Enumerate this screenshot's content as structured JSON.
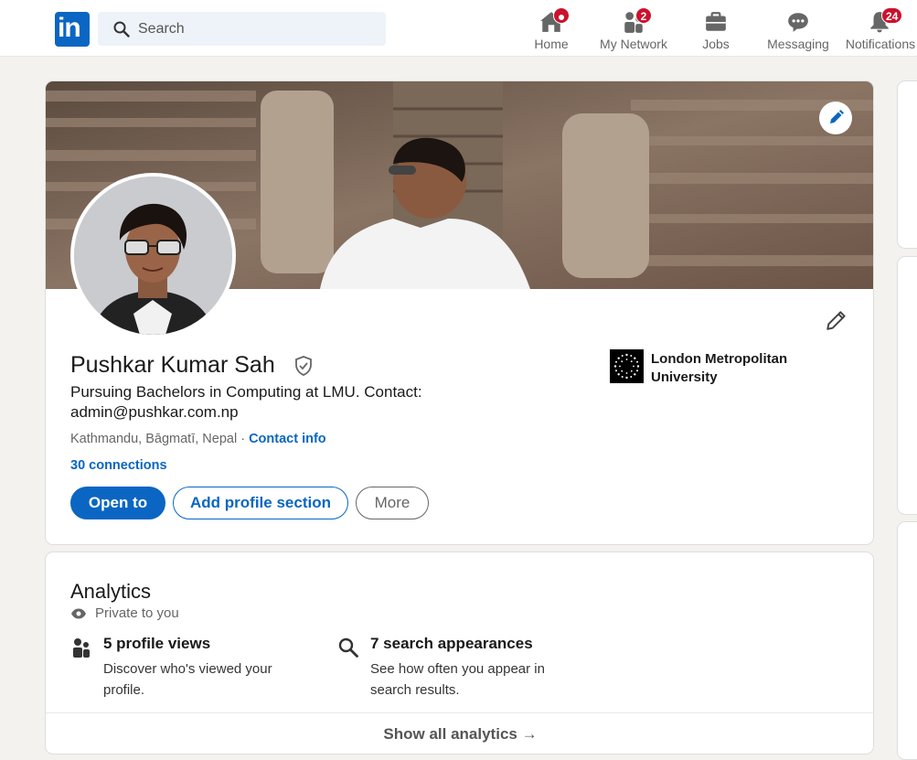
{
  "nav": {
    "logo_text": "in",
    "search_placeholder": "Search",
    "items": [
      {
        "label": "Home",
        "icon": "home-icon",
        "badge": ""
      },
      {
        "label": "My Network",
        "icon": "network-icon",
        "badge": "2"
      },
      {
        "label": "Jobs",
        "icon": "briefcase-icon",
        "badge": ""
      },
      {
        "label": "Messaging",
        "icon": "messaging-icon",
        "badge": ""
      },
      {
        "label": "Notifications",
        "icon": "bell-icon",
        "badge": "24"
      }
    ]
  },
  "profile": {
    "name": "Pushkar Kumar Sah",
    "headline": "Pursuing Bachelors in Computing at LMU. Contact: admin@pushkar.com.np",
    "location": "Kathmandu, Bāgmatī, Nepal",
    "separator": " · ",
    "contact_info_label": "Contact info",
    "connections": "30 connections",
    "buttons": {
      "open_to": "Open to",
      "add_section": "Add profile section",
      "more": "More"
    },
    "education": "London Metropolitan University"
  },
  "analytics": {
    "title": "Analytics",
    "privacy": "Private to you",
    "stats": [
      {
        "title": "5 profile views",
        "desc": "Discover who's viewed your profile."
      },
      {
        "title": "7 search appearances",
        "desc": "See how often you appear in search results."
      }
    ],
    "footer": "Show all analytics →"
  },
  "colors": {
    "brand": "#0a66c2",
    "badge": "#cb112d",
    "background": "#f4f2ee"
  }
}
